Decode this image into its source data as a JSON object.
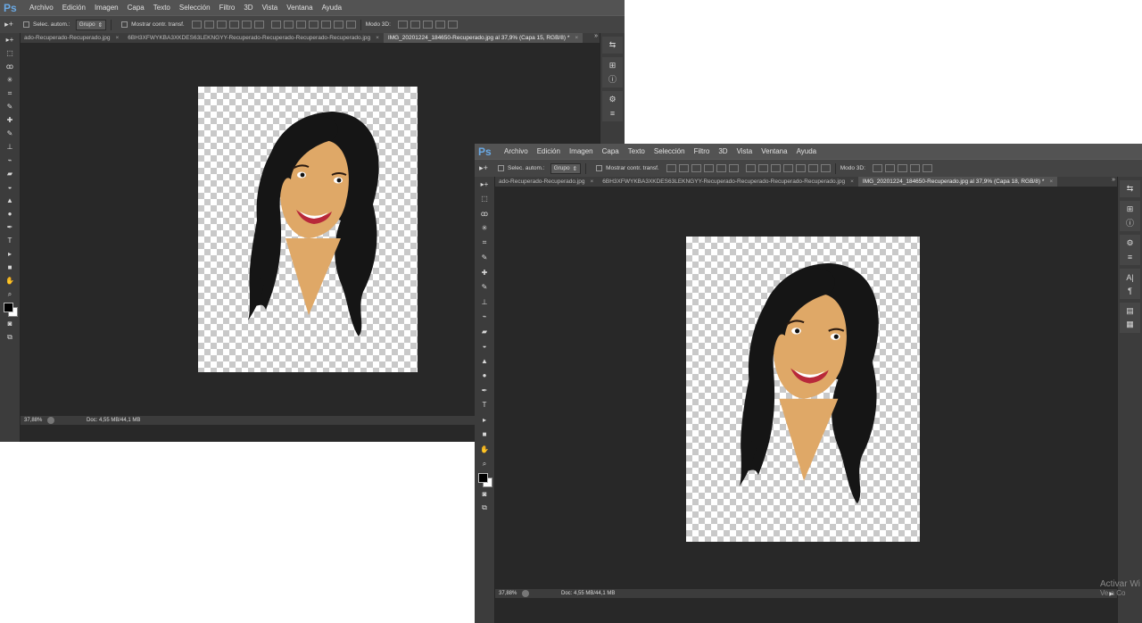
{
  "app": {
    "logo": "Ps",
    "menu": [
      "Archivo",
      "Edición",
      "Imagen",
      "Capa",
      "Texto",
      "Selección",
      "Filtro",
      "3D",
      "Vista",
      "Ventana",
      "Ayuda"
    ],
    "options": {
      "tool_glyph": "▸+",
      "auto_select_label": "Selec. autom.:",
      "auto_select_value": "Grupo",
      "transform_label": "Mostrar contr. transf.",
      "mode3d_label": "Modo 3D:"
    },
    "tabs": [
      {
        "label": "ado-Recuperado-Recuperado.jpg"
      },
      {
        "label": "6BH3XFWYKBA3XKDES63LEKNGYY-Recuperado-Recuperado-Recuperado-Recuperado.jpg"
      }
    ],
    "tabs_overflow": "»",
    "tools": [
      "▸+",
      "⬚",
      "ꝏ",
      "✳",
      "⌗",
      "✎",
      "✚",
      "✎",
      "⊥",
      "⌁",
      "▰",
      "◒",
      "▲",
      "●",
      "✒",
      "T",
      "▸",
      "■",
      "✋",
      "⌕"
    ],
    "extra_tools": [
      "◙",
      "⧉"
    ],
    "panel_icons": [
      "⇆",
      "⊞",
      "ⓘ",
      "⚙",
      "≡",
      "A|",
      "¶",
      "▤",
      "▦"
    ]
  },
  "back_window": {
    "active_tab": "IMG_20201224_184650-Recuperado.jpg al 37,9% (Capa 15, RGB/8) *",
    "zoom": "37,88%",
    "doc_size": "Doc: 4,55 MB/44,1 MB",
    "status_arrow": "▶"
  },
  "front_window": {
    "active_tab": "IMG_20201224_184650-Recuperado.jpg al 37,9% (Capa 18, RGB/8) *",
    "zoom": "37,88%",
    "doc_size": "Doc: 4,55 MB/44,1 MB",
    "status_arrow": "▶"
  },
  "watermark": {
    "line1": "Activar Wi",
    "line2": "Ve a Co"
  },
  "colors": {
    "skin": "#dfa867",
    "hair": "#151515",
    "lips": "#b8283a"
  }
}
